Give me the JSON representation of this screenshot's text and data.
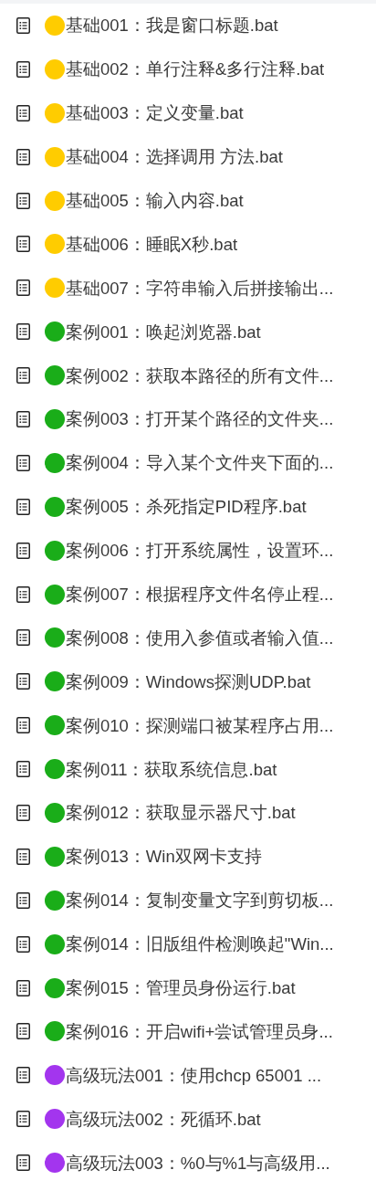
{
  "files": [
    {
      "color": "#ffcc00",
      "name": "基础001：我是窗口标题.bat"
    },
    {
      "color": "#ffcc00",
      "name": "基础002：单行注释&多行注释.bat"
    },
    {
      "color": "#ffcc00",
      "name": "基础003：定义变量.bat"
    },
    {
      "color": "#ffcc00",
      "name": "基础004：选择调用 方法.bat"
    },
    {
      "color": "#ffcc00",
      "name": "基础005：输入内容.bat"
    },
    {
      "color": "#ffcc00",
      "name": "基础006：睡眠X秒.bat"
    },
    {
      "color": "#ffcc00",
      "name": "基础007：字符串输入后拼接输出..."
    },
    {
      "color": "#1aad19",
      "name": "案例001：唤起浏览器.bat"
    },
    {
      "color": "#1aad19",
      "name": "案例002：获取本路径的所有文件..."
    },
    {
      "color": "#1aad19",
      "name": "案例003：打开某个路径的文件夹..."
    },
    {
      "color": "#1aad19",
      "name": "案例004：导入某个文件夹下面的..."
    },
    {
      "color": "#1aad19",
      "name": "案例005：杀死指定PID程序.bat"
    },
    {
      "color": "#1aad19",
      "name": "案例006：打开系统属性，设置环..."
    },
    {
      "color": "#1aad19",
      "name": "案例007：根据程序文件名停止程..."
    },
    {
      "color": "#1aad19",
      "name": "案例008：使用入参值或者输入值..."
    },
    {
      "color": "#1aad19",
      "name": "案例009：Windows探测UDP.bat"
    },
    {
      "color": "#1aad19",
      "name": "案例010：探测端口被某程序占用..."
    },
    {
      "color": "#1aad19",
      "name": "案例011：获取系统信息.bat"
    },
    {
      "color": "#1aad19",
      "name": "案例012：获取显示器尺寸.bat"
    },
    {
      "color": "#1aad19",
      "name": "案例013：Win双网卡支持"
    },
    {
      "color": "#1aad19",
      "name": "案例014：复制变量文字到剪切板..."
    },
    {
      "color": "#1aad19",
      "name": "案例014：旧版组件检测唤起\"Win..."
    },
    {
      "color": "#1aad19",
      "name": "案例015：管理员身份运行.bat"
    },
    {
      "color": "#1aad19",
      "name": "案例016：开启wifi+尝试管理员身..."
    },
    {
      "color": "#a335ee",
      "name": "高级玩法001：使用chcp 65001 ..."
    },
    {
      "color": "#a335ee",
      "name": "高级玩法002：死循环.bat"
    },
    {
      "color": "#a335ee",
      "name": "高级玩法003：%0与%1与高级用..."
    }
  ]
}
